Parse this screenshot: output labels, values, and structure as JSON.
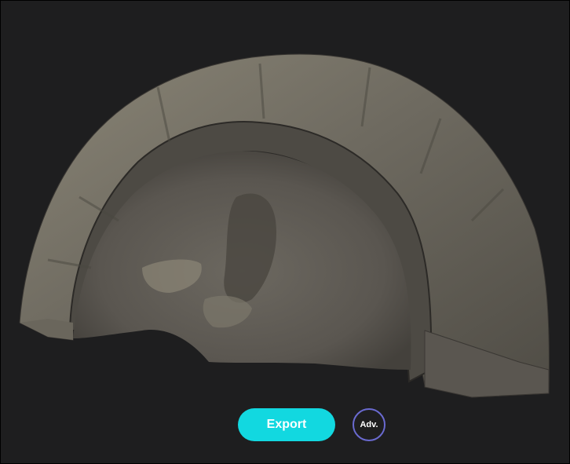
{
  "viewer": {
    "background": "#1e1e1f",
    "model_colors": {
      "outer": "#6e6a60",
      "inner": "#5e5a54",
      "highlight": "#8c8676",
      "shadow": "#2c2a27"
    }
  },
  "actions": {
    "export_label": "Export",
    "export_color": "#12d8e0",
    "adv_label": "Adv.",
    "adv_ring_color": "#6a6ad0"
  }
}
